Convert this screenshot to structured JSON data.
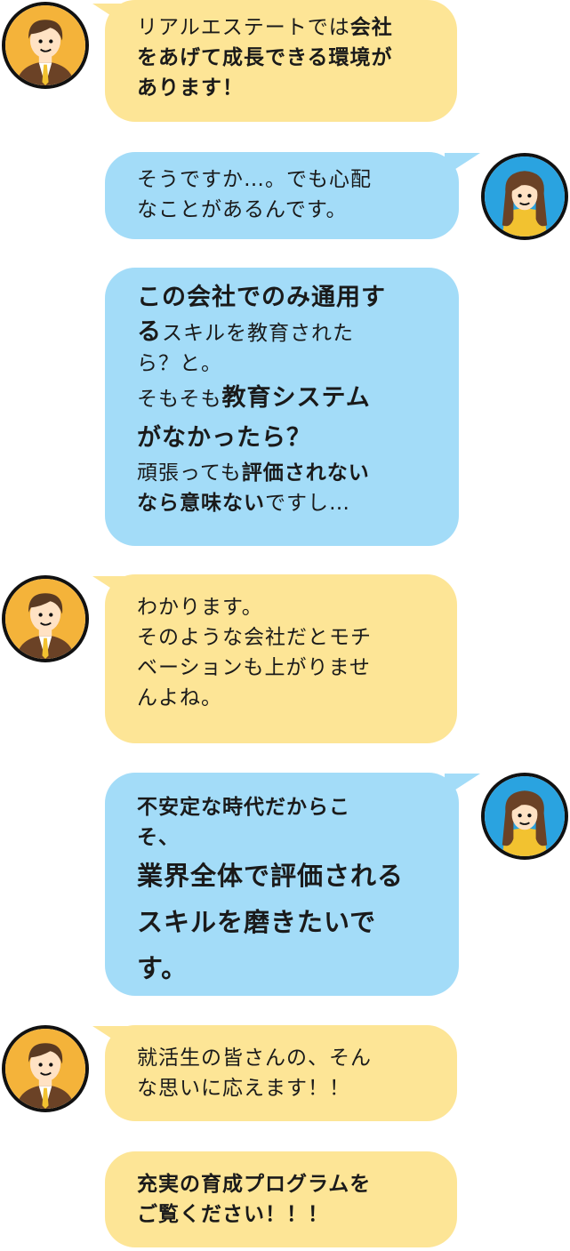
{
  "colors": {
    "man_bubble": "#fde596",
    "woman_bubble": "#a3dcf8",
    "avatar_man_bg": "#f4b33a",
    "avatar_woman_bg": "#2aa3e0"
  },
  "avatars": {
    "man_icon": "businessman-avatar-icon",
    "woman_icon": "student-woman-avatar-icon"
  },
  "conversation": {
    "m1": {
      "speaker": "company",
      "l1a": "リアルエステートでは",
      "l1b": "会社",
      "l2": "をあげて成長できる環境が",
      "l3": "あります！"
    },
    "m2": {
      "speaker": "student",
      "l1": "そうですか…。でも心配",
      "l2": "なことがあるんです。"
    },
    "m3": {
      "speaker": "student",
      "l1": "この会社でのみ通用す",
      "l2a": "る",
      "l2b": "スキルを教育された",
      "l3": "ら？と。",
      "l4a": "そもそも",
      "l4b": "教育システム",
      "l5": "がなかったら？",
      "l6a": "頑張っても",
      "l6b": "評価されない",
      "l7a": "なら意味ない",
      "l7b": "ですし…"
    },
    "m4": {
      "speaker": "company",
      "l1": "わかります。",
      "l2": "そのような会社だとモチ",
      "l3": "ベーションも上がりませ",
      "l4": "んよね。"
    },
    "m5": {
      "speaker": "student",
      "l1": "不安定な時代だからこ",
      "l2": "そ、",
      "l3": "業界全体で評価される",
      "l4": "スキルを磨きたいで",
      "l5": "す。"
    },
    "m6": {
      "speaker": "company",
      "l1": "就活生の皆さんの、そん",
      "l2": "な思いに応えます！！"
    },
    "m7": {
      "speaker": "company",
      "l1": "充実の育成プログラムを",
      "l2": "ご覧ください！！！"
    }
  }
}
